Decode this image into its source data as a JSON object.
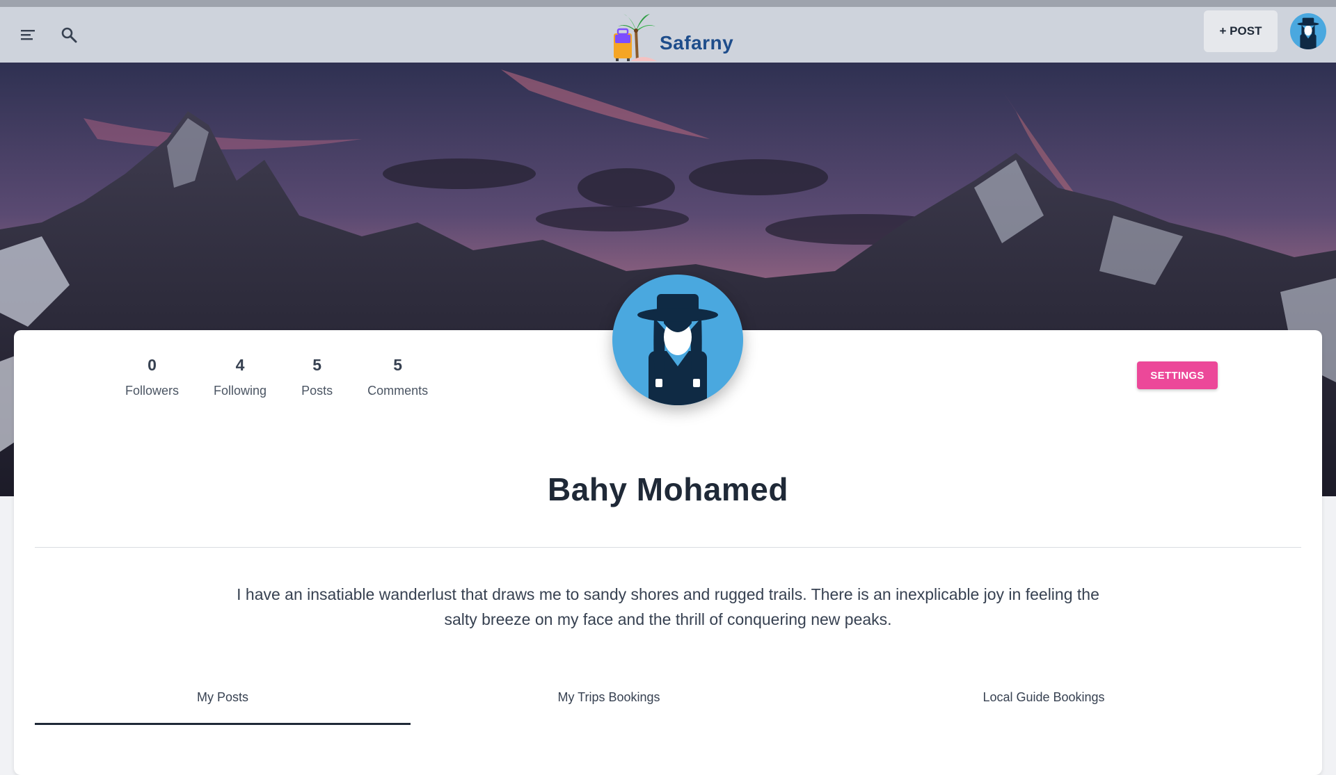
{
  "app": {
    "name": "Safarny"
  },
  "navbar": {
    "post_label": "+ POST"
  },
  "profile": {
    "name": "Bahy Mohamed",
    "bio": "I have an insatiable wanderlust that draws me to sandy shores and rugged trails. There is an inexplicable joy in feeling the salty breeze on my face and the thrill of conquering new peaks.",
    "settings_label": "SETTINGS",
    "stats": [
      {
        "value": "0",
        "label": "Followers"
      },
      {
        "value": "4",
        "label": "Following"
      },
      {
        "value": "5",
        "label": "Posts"
      },
      {
        "value": "5",
        "label": "Comments"
      }
    ]
  },
  "tabs": [
    {
      "label": "My Posts",
      "active": true
    },
    {
      "label": "My Trips Bookings",
      "active": false
    },
    {
      "label": "Local Guide Bookings",
      "active": false
    }
  ],
  "colors": {
    "accent": "#ec4899",
    "brand": "#1e4d8b",
    "avatar_bg": "#4aa8df"
  },
  "icons": [
    "menu-icon",
    "search-icon",
    "logo-icon",
    "avatar-icon"
  ]
}
